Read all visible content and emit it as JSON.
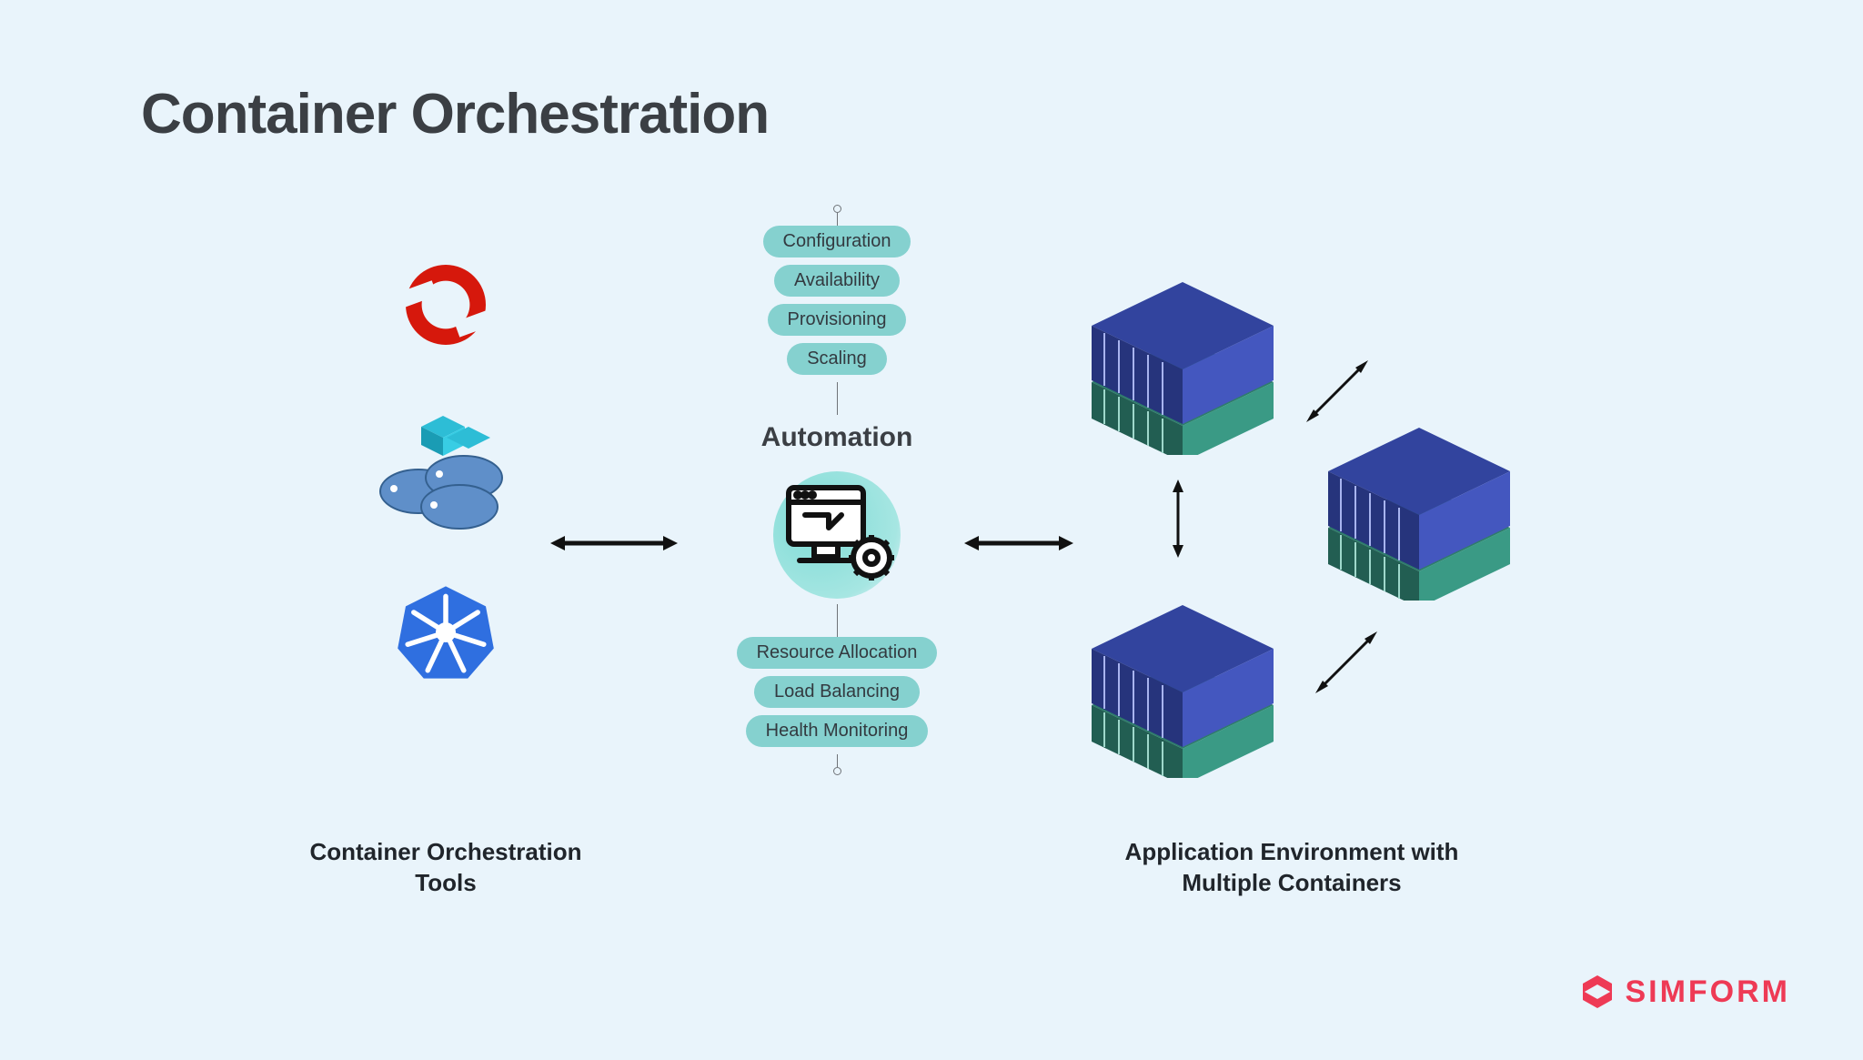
{
  "title": "Container Orchestration",
  "tools": {
    "caption_line1": "Container Orchestration",
    "caption_line2": "Tools",
    "items": [
      "openshift",
      "docker-swarm",
      "kubernetes"
    ]
  },
  "automation": {
    "label": "Automation",
    "top_pills": [
      "Configuration",
      "Availability",
      "Provisioning",
      "Scaling"
    ],
    "bottom_pills": [
      "Resource Allocation",
      "Load Balancing",
      "Health Monitoring"
    ]
  },
  "env": {
    "caption_line1": "Application Environment with",
    "caption_line2": "Multiple Containers"
  },
  "brand": "SIMFORM",
  "colors": {
    "pill": "#85d1cf",
    "brand": "#ee3a55",
    "container_top": "#3a4db3",
    "container_bottom": "#2f8f7e"
  }
}
